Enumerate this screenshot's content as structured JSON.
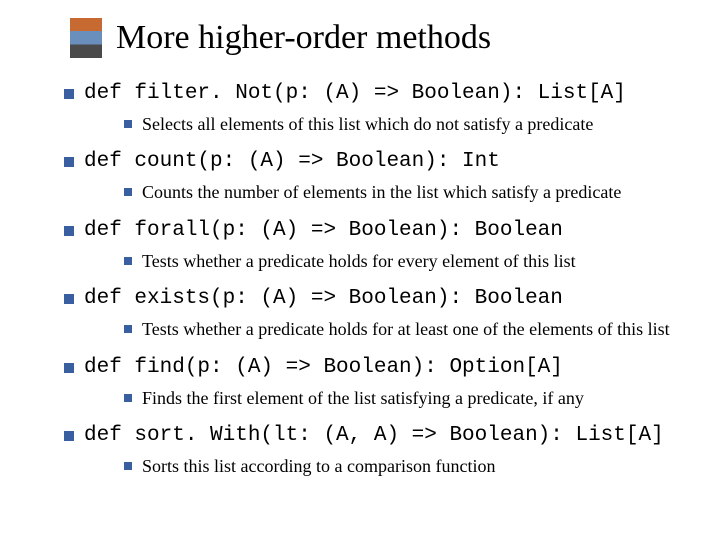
{
  "title": "More higher-order methods",
  "items": [
    {
      "sig": "def filter. Not(p: (A) => Boolean): List[A]",
      "desc": "Selects all elements of this list which do not satisfy a predicate"
    },
    {
      "sig": "def count(p: (A) => Boolean): Int",
      "desc": "Counts the number of elements in the list which satisfy a predicate"
    },
    {
      "sig": "def forall(p: (A) => Boolean): Boolean",
      "desc": "Tests whether a predicate holds for every element of this list"
    },
    {
      "sig": "def exists(p: (A) => Boolean): Boolean",
      "desc": "Tests whether a predicate holds for at least one of the elements of this list"
    },
    {
      "sig": "def find(p: (A) => Boolean): Option[A]",
      "desc": "Finds the first element of the list satisfying a predicate, if any"
    },
    {
      "sig": "def sort. With(lt: (A, A) => Boolean): List[A]",
      "desc": "Sorts this list according to a comparison function"
    }
  ]
}
